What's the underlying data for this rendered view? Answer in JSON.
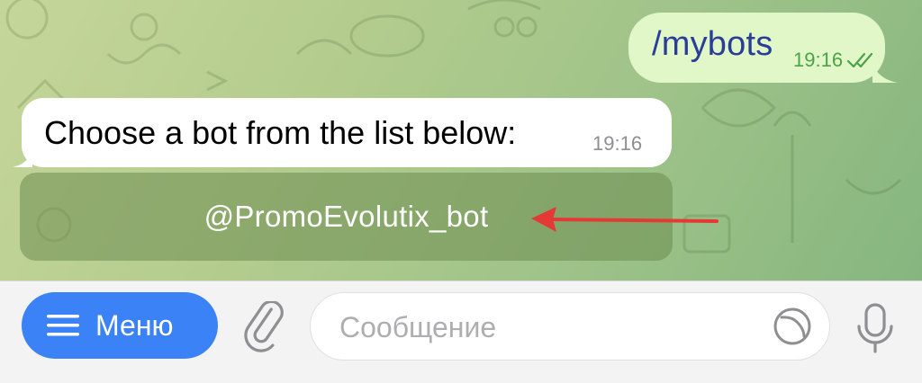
{
  "chat": {
    "outgoing": {
      "text": "/mybots",
      "time": "19:16",
      "status_icon": "double-check-icon"
    },
    "incoming": {
      "text": "Choose a bot from the list below:",
      "time": "19:16"
    },
    "keyboard_button": {
      "label": "@PromoEvolutix_bot"
    },
    "annotation": {
      "type": "arrow",
      "color": "#e53935"
    }
  },
  "composer": {
    "menu_label": "Меню",
    "menu_icon": "hamburger-icon",
    "attach_icon": "paperclip-icon",
    "placeholder": "Сообщение",
    "sticker_icon": "sticker-icon",
    "mic_icon": "microphone-icon"
  },
  "colors": {
    "accent": "#3a82f6",
    "outgoing_bubble": "#e2f7c8",
    "outgoing_text": "#2a3e98",
    "read_check": "#4aa34a",
    "chat_background": "#a8c888"
  }
}
